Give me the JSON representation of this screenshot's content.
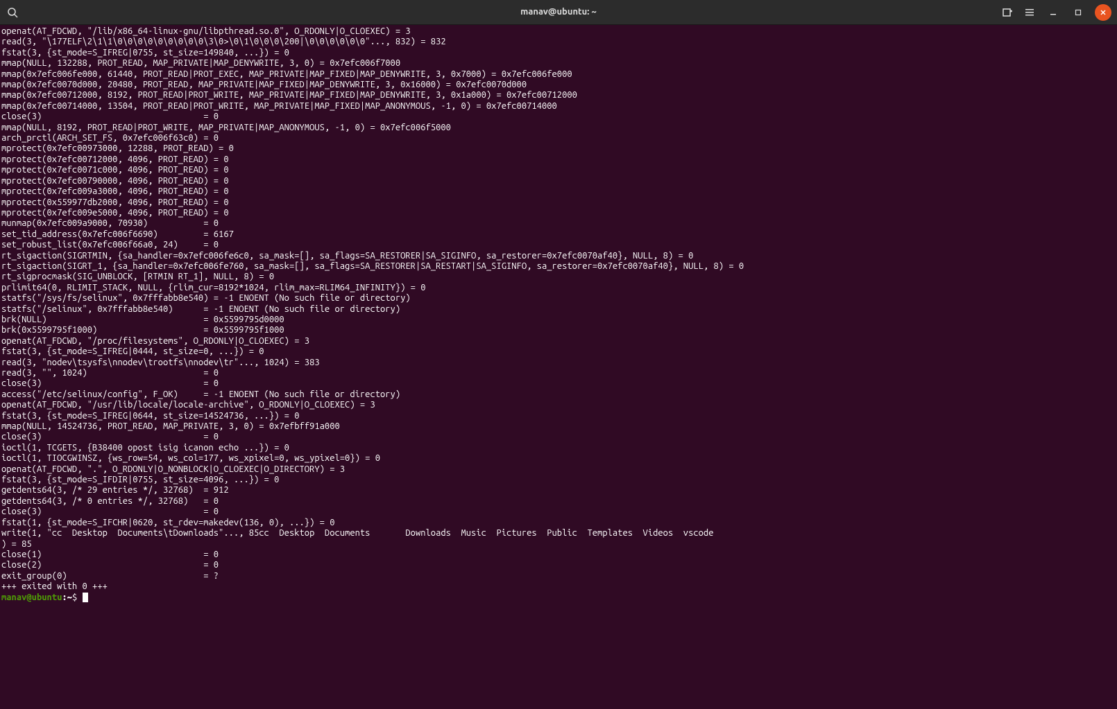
{
  "titlebar": {
    "title": "manav@ubuntu: ~"
  },
  "terminal": {
    "lines": [
      "openat(AT_FDCWD, \"/lib/x86_64-linux-gnu/libpthread.so.0\", O_RDONLY|O_CLOEXEC) = 3",
      "read(3, \"\\177ELF\\2\\1\\1\\0\\0\\0\\0\\0\\0\\0\\0\\0\\3\\0>\\0\\1\\0\\0\\0\\200|\\0\\0\\0\\0\\0\\0\"..., 832) = 832",
      "fstat(3, {st_mode=S_IFREG|0755, st_size=149840, ...}) = 0",
      "mmap(NULL, 132288, PROT_READ, MAP_PRIVATE|MAP_DENYWRITE, 3, 0) = 0x7efc006f7000",
      "mmap(0x7efc006fe000, 61440, PROT_READ|PROT_EXEC, MAP_PRIVATE|MAP_FIXED|MAP_DENYWRITE, 3, 0x7000) = 0x7efc006fe000",
      "mmap(0x7efc0070d000, 20480, PROT_READ, MAP_PRIVATE|MAP_FIXED|MAP_DENYWRITE, 3, 0x16000) = 0x7efc0070d000",
      "mmap(0x7efc00712000, 8192, PROT_READ|PROT_WRITE, MAP_PRIVATE|MAP_FIXED|MAP_DENYWRITE, 3, 0x1a000) = 0x7efc00712000",
      "mmap(0x7efc00714000, 13504, PROT_READ|PROT_WRITE, MAP_PRIVATE|MAP_FIXED|MAP_ANONYMOUS, -1, 0) = 0x7efc00714000",
      "close(3)                                = 0",
      "mmap(NULL, 8192, PROT_READ|PROT_WRITE, MAP_PRIVATE|MAP_ANONYMOUS, -1, 0) = 0x7efc006f5000",
      "arch_prctl(ARCH_SET_FS, 0x7efc006f63c0) = 0",
      "mprotect(0x7efc00973000, 12288, PROT_READ) = 0",
      "mprotect(0x7efc00712000, 4096, PROT_READ) = 0",
      "mprotect(0x7efc0071c000, 4096, PROT_READ) = 0",
      "mprotect(0x7efc00790000, 4096, PROT_READ) = 0",
      "mprotect(0x7efc009a3000, 4096, PROT_READ) = 0",
      "mprotect(0x559977db2000, 4096, PROT_READ) = 0",
      "mprotect(0x7efc009e5000, 4096, PROT_READ) = 0",
      "munmap(0x7efc009a9000, 70930)           = 0",
      "set_tid_address(0x7efc006f6690)         = 6167",
      "set_robust_list(0x7efc006f66a0, 24)     = 0",
      "rt_sigaction(SIGRTMIN, {sa_handler=0x7efc006fe6c0, sa_mask=[], sa_flags=SA_RESTORER|SA_SIGINFO, sa_restorer=0x7efc0070af40}, NULL, 8) = 0",
      "rt_sigaction(SIGRT_1, {sa_handler=0x7efc006fe760, sa_mask=[], sa_flags=SA_RESTORER|SA_RESTART|SA_SIGINFO, sa_restorer=0x7efc0070af40}, NULL, 8) = 0",
      "rt_sigprocmask(SIG_UNBLOCK, [RTMIN RT_1], NULL, 8) = 0",
      "prlimit64(0, RLIMIT_STACK, NULL, {rlim_cur=8192*1024, rlim_max=RLIM64_INFINITY}) = 0",
      "statfs(\"/sys/fs/selinux\", 0x7fffabb8e540) = -1 ENOENT (No such file or directory)",
      "statfs(\"/selinux\", 0x7fffabb8e540)      = -1 ENOENT (No such file or directory)",
      "brk(NULL)                               = 0x5599795d0000",
      "brk(0x5599795f1000)                     = 0x5599795f1000",
      "openat(AT_FDCWD, \"/proc/filesystems\", O_RDONLY|O_CLOEXEC) = 3",
      "fstat(3, {st_mode=S_IFREG|0444, st_size=0, ...}) = 0",
      "read(3, \"nodev\\tsysfs\\nnodev\\trootfs\\nnodev\\tr\"..., 1024) = 383",
      "read(3, \"\", 1024)                       = 0",
      "close(3)                                = 0",
      "access(\"/etc/selinux/config\", F_OK)     = -1 ENOENT (No such file or directory)",
      "openat(AT_FDCWD, \"/usr/lib/locale/locale-archive\", O_RDONLY|O_CLOEXEC) = 3",
      "fstat(3, {st_mode=S_IFREG|0644, st_size=14524736, ...}) = 0",
      "mmap(NULL, 14524736, PROT_READ, MAP_PRIVATE, 3, 0) = 0x7efbff91a000",
      "close(3)                                = 0",
      "ioctl(1, TCGETS, {B38400 opost isig icanon echo ...}) = 0",
      "ioctl(1, TIOCGWINSZ, {ws_row=54, ws_col=177, ws_xpixel=0, ws_ypixel=0}) = 0",
      "openat(AT_FDCWD, \".\", O_RDONLY|O_NONBLOCK|O_CLOEXEC|O_DIRECTORY) = 3",
      "fstat(3, {st_mode=S_IFDIR|0755, st_size=4096, ...}) = 0",
      "getdents64(3, /* 29 entries */, 32768)  = 912",
      "getdents64(3, /* 0 entries */, 32768)   = 0",
      "close(3)                                = 0",
      "fstat(1, {st_mode=S_IFCHR|0620, st_rdev=makedev(136, 0), ...}) = 0",
      "write(1, \"cc  Desktop  Documents\\tDownloads\"..., 85cc  Desktop  Documents       Downloads  Music  Pictures  Public  Templates  Videos  vscode",
      ") = 85",
      "close(1)                                = 0",
      "close(2)                                = 0",
      "exit_group(0)                           = ?",
      "+++ exited with 0 +++"
    ],
    "prompt": {
      "user_host": "manav@ubuntu",
      "separator": ":",
      "path": "~",
      "dollar": "$ "
    }
  }
}
